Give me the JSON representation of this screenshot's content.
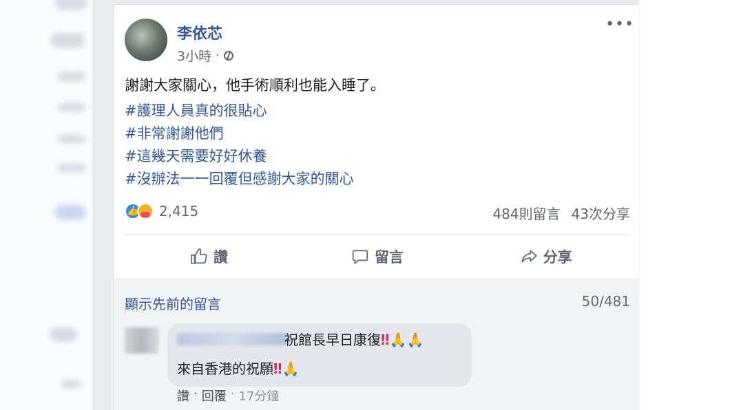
{
  "post": {
    "author": "李依芯",
    "time": "3小時",
    "separator": "·",
    "more_label": "•••",
    "text": "謝謝大家關心，他手術順利也能入睡了。",
    "hashtags": [
      "#護理人員真的很貼心",
      "#非常謝謝他們",
      "#這幾天需要好好休養",
      "#沒辦法一一回覆但感謝大家的關心"
    ],
    "reaction_count": "2,415",
    "comments_count": "484則留言",
    "shares_count": "43次分享",
    "actions": {
      "like": "讚",
      "comment": "留言",
      "share": "分享"
    }
  },
  "comments": {
    "show_previous": "顯示先前的留言",
    "pager": "50/481",
    "items": [
      {
        "line1_text": "祝館長早日康復",
        "line1_marks": "‼",
        "line1_emoji": "🙏🙏",
        "line2_text": "來自香港的祝願",
        "line2_marks": "‼",
        "line2_emoji": "🙏",
        "like": "讚",
        "dot1": "·",
        "reply": "回覆",
        "dot2": "·",
        "time": "17分鐘"
      }
    ]
  },
  "colors": {
    "link": "#365899",
    "secondary_text": "#616770",
    "like_blue": "#2d88ff"
  }
}
